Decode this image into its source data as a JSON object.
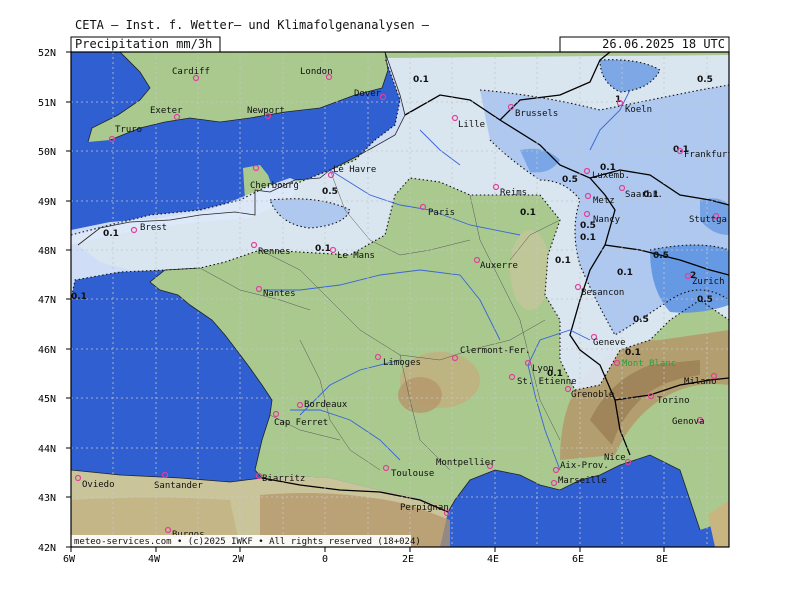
{
  "header": {
    "institute": "CETA — Inst. f. Wetter— und Klimafolgenanalysen —",
    "parameter": "Precipitation  mm/3h",
    "valid": "26.06.2025  18 UTC"
  },
  "footer": {
    "credit": "meteo-services.com • (c)2025 IWKF • All rights reserved (18+024)"
  },
  "axes": {
    "lat_labels": [
      "52N",
      "51N",
      "50N",
      "49N",
      "48N",
      "47N",
      "46N",
      "45N",
      "44N",
      "43N",
      "42N"
    ],
    "lon_labels": [
      "6W",
      "4W",
      "2W",
      "0",
      "2E",
      "4E",
      "6E",
      "8E"
    ]
  },
  "colors": {
    "sea": "#2f5fd0",
    "land_low": "#a9c98f",
    "land_high": "#b5966a",
    "precip_light": "#dde8f8",
    "precip_mid": "#a8c4ee",
    "precip_heavy": "#5e93e2",
    "city": "#e0409a"
  },
  "cities": [
    {
      "name": "Cardiff"
    },
    {
      "name": "London"
    },
    {
      "name": "Exeter"
    },
    {
      "name": "Newport"
    },
    {
      "name": "Dover"
    },
    {
      "name": "Truro"
    },
    {
      "name": "Lille"
    },
    {
      "name": "Brussels"
    },
    {
      "name": "Koeln"
    },
    {
      "name": "Frankfurt"
    },
    {
      "name": "Le Havre"
    },
    {
      "name": "Cherbourg"
    },
    {
      "name": "Reims"
    },
    {
      "name": "Luxemb."
    },
    {
      "name": "Metz"
    },
    {
      "name": "Saarbr."
    },
    {
      "name": "Paris"
    },
    {
      "name": "Nancy"
    },
    {
      "name": "Stuttgart"
    },
    {
      "name": "Brest"
    },
    {
      "name": "Rennes"
    },
    {
      "name": "Le Mans"
    },
    {
      "name": "Auxerre"
    },
    {
      "name": "Nantes"
    },
    {
      "name": "Besancon"
    },
    {
      "name": "Zurich"
    },
    {
      "name": "Geneve"
    },
    {
      "name": "Limoges"
    },
    {
      "name": "Clermont-Fer."
    },
    {
      "name": "Mont Blanc"
    },
    {
      "name": "Lyon"
    },
    {
      "name": "St. Etienne"
    },
    {
      "name": "Milano"
    },
    {
      "name": "Grenoble"
    },
    {
      "name": "Bordeaux"
    },
    {
      "name": "Torino"
    },
    {
      "name": "Cap Ferret"
    },
    {
      "name": "Genova"
    },
    {
      "name": "Nice"
    },
    {
      "name": "Montpellier"
    },
    {
      "name": "Aix-Prov."
    },
    {
      "name": "Toulouse"
    },
    {
      "name": "Oviedo"
    },
    {
      "name": "Santander"
    },
    {
      "name": "Biarritz"
    },
    {
      "name": "Marseille"
    },
    {
      "name": "Perpignan"
    },
    {
      "name": "Burgos"
    }
  ],
  "contour_values": {
    "c1": "0.1",
    "c2": "0.5",
    "c3": "0.1",
    "c4": "0.5",
    "c5": "1",
    "c6": "0.1",
    "c7": "0.5",
    "c8": "0.1",
    "c9": "0.5",
    "c10": "0.1",
    "c11": "0.1",
    "c12": "0.1",
    "c13": "0.5",
    "c14": "0.1",
    "c15": "0.1",
    "c16": "2",
    "c17": "0.5",
    "c18": "0.1",
    "c19": "0.1",
    "c20": "0.1",
    "c21": "0.1",
    "c22": "0.5"
  }
}
